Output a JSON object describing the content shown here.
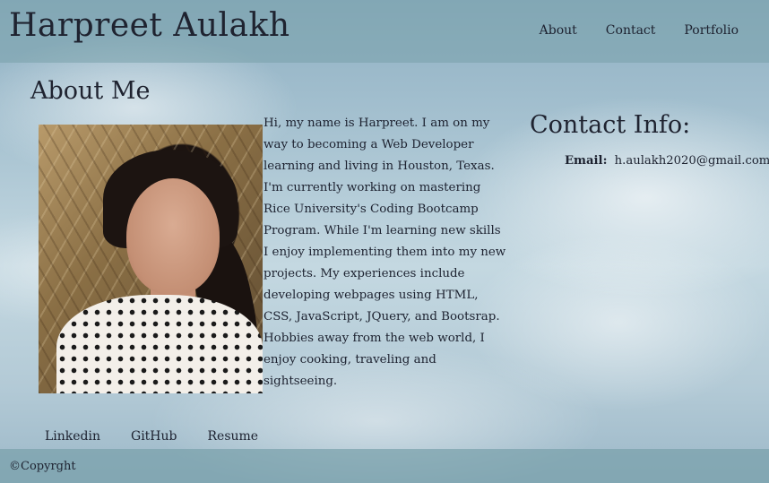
{
  "header": {
    "site_title": "Harpreet Aulakh",
    "nav": [
      {
        "label": "About"
      },
      {
        "label": "Contact"
      },
      {
        "label": "Portfolio"
      }
    ]
  },
  "about": {
    "heading": "About Me",
    "bio": "Hi, my name is Harpreet. I am on my way to becoming a Web Developer learning and living in Houston, Texas. I'm currently working on mastering Rice University's Coding Bootcamp Program. While I'm learning new skills I enjoy implementing them into my new projects. My experiences include developing webpages using HTML, CSS, JavaScript, JQuery, and Bootsrap. Hobbies away from the web world, I enjoy cooking, traveling and sightseeing."
  },
  "contact": {
    "heading": "Contact Info:",
    "email_label": "Email:",
    "email": "h.aulakh2020@gmail.com"
  },
  "links": [
    {
      "label": "Linkedin"
    },
    {
      "label": "GitHub"
    },
    {
      "label": "Resume"
    }
  ],
  "footer": {
    "copyright": "©Copyrght"
  }
}
